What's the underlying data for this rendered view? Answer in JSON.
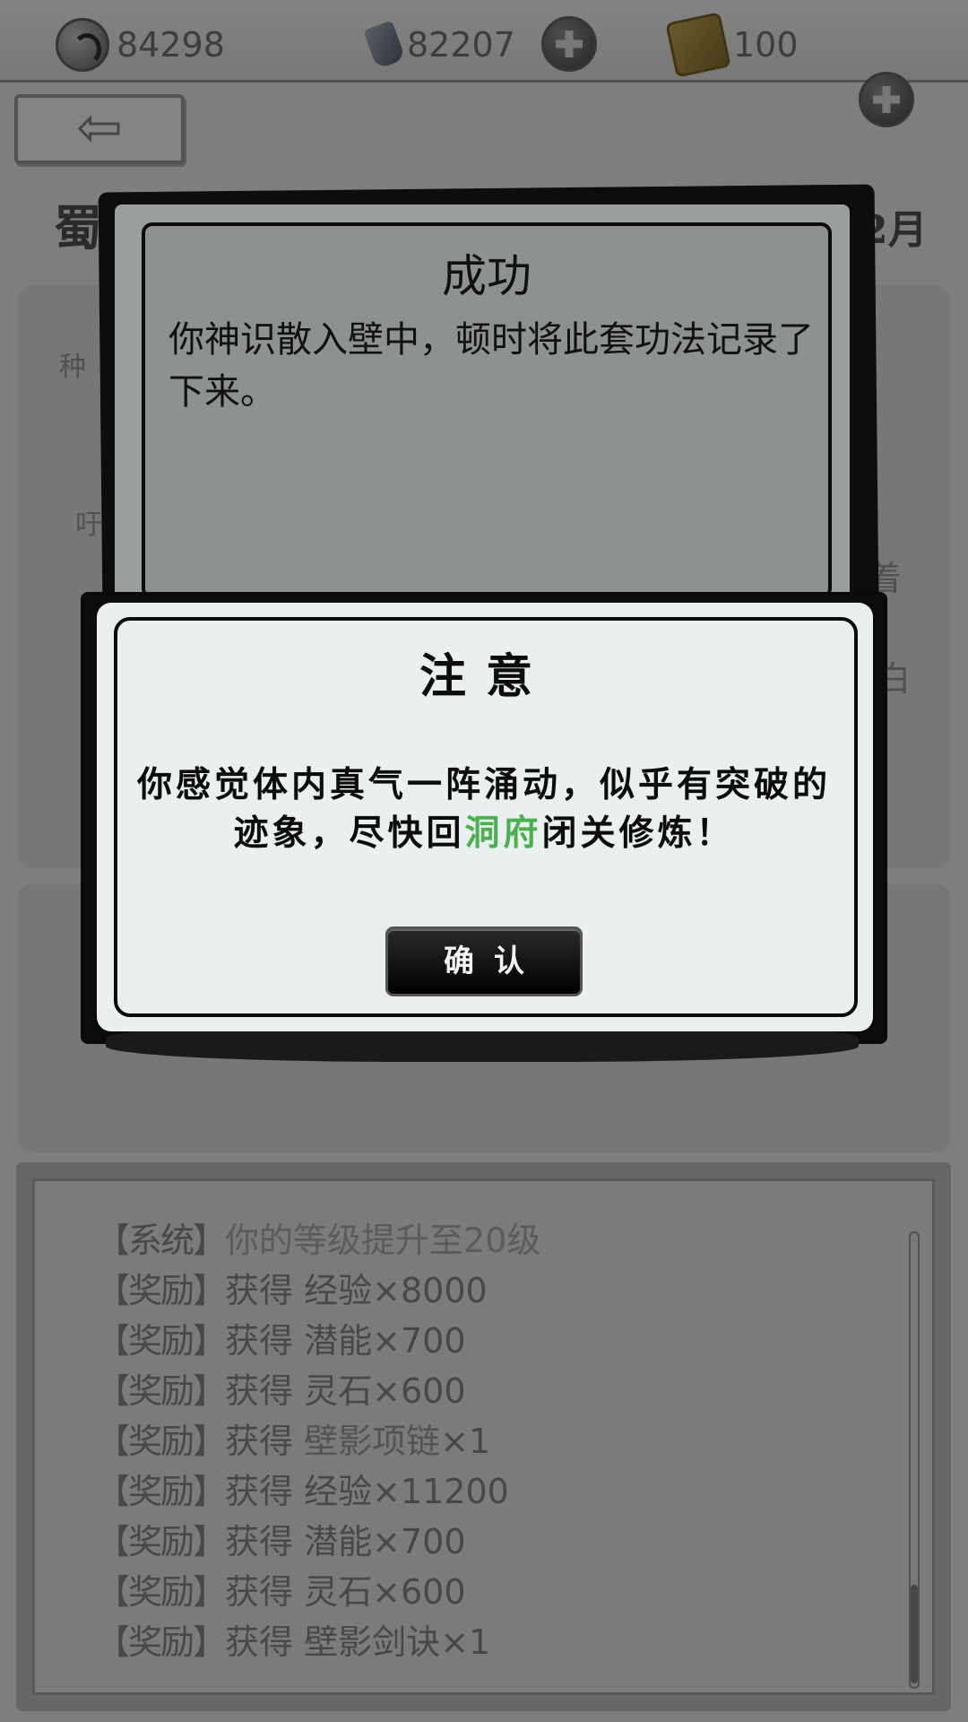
{
  "resources": {
    "coins": "84298",
    "gems": "82207",
    "tomes": "100"
  },
  "background": {
    "back_arrow": "⇦",
    "heading_left": "蜀",
    "heading_right": "2月",
    "side_text_1": "种",
    "side_text_2": "吁",
    "side_right_1": "着",
    "side_right_2": "白"
  },
  "log": {
    "lines": [
      {
        "tag": "【系统】",
        "prefix": "",
        "text": "你的等级提升至20级",
        "suffix": ""
      },
      {
        "tag": "【奖励】",
        "prefix": "获得 ",
        "text": "经验",
        "suffix": "×8000"
      },
      {
        "tag": "【奖励】",
        "prefix": "获得 ",
        "text": "潜能",
        "suffix": "×700"
      },
      {
        "tag": "【奖励】",
        "prefix": "获得 ",
        "text": "灵石",
        "suffix": "×600"
      },
      {
        "tag": "【奖励】",
        "prefix": "获得 ",
        "text": "壁影项链",
        "suffix": "×1"
      },
      {
        "tag": "【奖励】",
        "prefix": "获得 ",
        "text": "经验",
        "suffix": "×11200"
      },
      {
        "tag": "【奖励】",
        "prefix": "获得 ",
        "text": "潜能",
        "suffix": "×700"
      },
      {
        "tag": "【奖励】",
        "prefix": "获得 ",
        "text": "灵石",
        "suffix": "×600"
      },
      {
        "tag": "【奖励】",
        "prefix": "获得 ",
        "text": "壁影剑诀",
        "suffix": "×1"
      }
    ]
  },
  "success_dialog": {
    "title": "成功",
    "message": "你神识散入壁中，顿时将此套功法记录了下来。"
  },
  "notice_dialog": {
    "title": "注意",
    "message_before": "你感觉体内真气一阵涌动，似乎有突破的迹象，尽快回",
    "message_highlight": "洞府",
    "message_after": "闭关修炼！",
    "confirm_label": "确认"
  },
  "colors": {
    "highlight_green": "#4caf50",
    "ink": "#0c0c0c",
    "notice_bg": "#e9f0ef"
  }
}
